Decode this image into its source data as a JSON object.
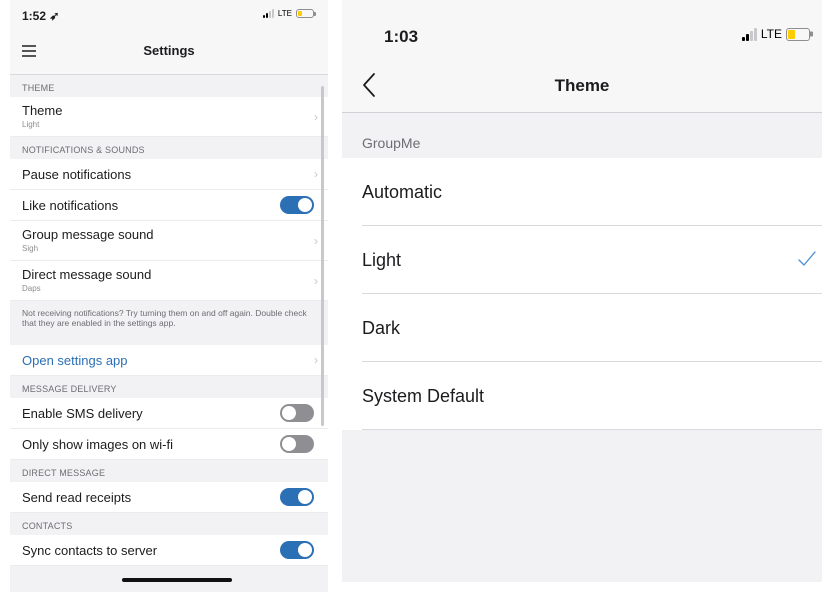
{
  "left": {
    "status": {
      "time": "1:52 ➶",
      "network": "LTE"
    },
    "nav": {
      "title": "Settings",
      "menu_icon": "hamburger-menu-icon"
    },
    "sections": {
      "theme": {
        "header": "THEME",
        "theme_row": {
          "label": "Theme",
          "value": "Light"
        }
      },
      "notifications": {
        "header": "NOTIFICATIONS & SOUNDS",
        "pause": {
          "label": "Pause notifications"
        },
        "like": {
          "label": "Like notifications",
          "on": true
        },
        "group_sound": {
          "label": "Group message sound",
          "value": "Sigh"
        },
        "direct_sound": {
          "label": "Direct message sound",
          "value": "Daps"
        },
        "note": "Not receiving notifications? Try turning them on and off again. Double check that they are enabled in the settings app.",
        "open_settings": {
          "label": "Open settings app"
        }
      },
      "delivery": {
        "header": "MESSAGE DELIVERY",
        "sms": {
          "label": "Enable SMS delivery",
          "on": false
        },
        "wifi_images": {
          "label": "Only show images on wi-fi",
          "on": false
        }
      },
      "direct": {
        "header": "DIRECT MESSAGE",
        "read_receipts": {
          "label": "Send read receipts",
          "on": true
        }
      },
      "contacts": {
        "header": "CONTACTS",
        "sync": {
          "label": "Sync contacts to server",
          "on": true
        }
      }
    }
  },
  "right": {
    "status": {
      "time": "1:03",
      "network": "LTE"
    },
    "nav": {
      "title": "Theme",
      "back_icon": "chevron-left-icon"
    },
    "group_header": "GroupMe",
    "options": [
      {
        "label": "Automatic",
        "selected": false
      },
      {
        "label": "Light",
        "selected": true
      },
      {
        "label": "Dark",
        "selected": false
      },
      {
        "label": "System Default",
        "selected": false
      }
    ]
  },
  "colors": {
    "accent": "#2b6fb5",
    "toggle_off": "#8e8e93",
    "checkmark": "#4a8fd8",
    "battery": "#ffcc00",
    "background": "#f2f2f4"
  }
}
